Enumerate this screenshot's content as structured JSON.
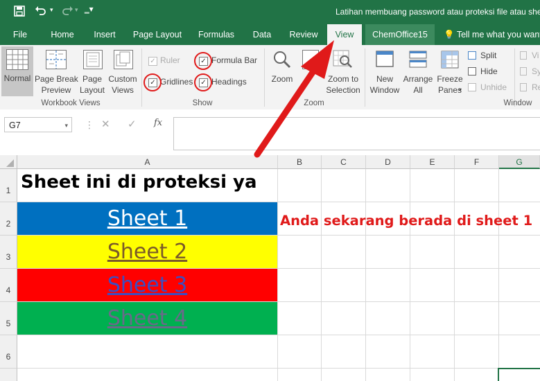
{
  "window": {
    "title": "Latihan membuang password atau proteksi file atau she"
  },
  "quick_access": {
    "save_icon": "save-icon",
    "undo_icon": "undo-icon",
    "redo_icon": "redo-icon",
    "customize_icon": "chevron-down-icon"
  },
  "tabs": [
    "File",
    "Home",
    "Insert",
    "Page Layout",
    "Formulas",
    "Data",
    "Review",
    "View",
    "ChemOffice15"
  ],
  "tell_me": "Tell me what you want",
  "ribbon": {
    "workbook_views": {
      "group_label": "Workbook Views",
      "normal": "Normal",
      "page_break_1": "Page Break",
      "page_break_2": "Preview",
      "page_layout_1": "Page",
      "page_layout_2": "Layout",
      "custom_views_1": "Custom",
      "custom_views_2": "Views"
    },
    "show": {
      "group_label": "Show",
      "ruler": "Ruler",
      "formula_bar": "Formula Bar",
      "gridlines": "Gridlines",
      "headings": "Headings"
    },
    "zoom": {
      "group_label": "Zoom",
      "zoom": "Zoom",
      "zoom_selection_1": "Zoom to",
      "zoom_selection_2": "Selection"
    },
    "window": {
      "group_label": "Window",
      "new_window_1": "New",
      "new_window_2": "Window",
      "arrange_all_1": "Arrange",
      "arrange_all_2": "All",
      "freeze_panes_1": "Freeze",
      "freeze_panes_2": "Panes",
      "split": "Split",
      "hide": "Hide",
      "unhide": "Unhide",
      "view_side": "Vi",
      "sync": "Sy",
      "reset": "Re"
    }
  },
  "formula_bar": {
    "name_box": "G7",
    "cancel_icon": "close-icon",
    "enter_icon": "check-icon",
    "function_label": "fx",
    "value": ""
  },
  "columns": [
    "A",
    "B",
    "C",
    "D",
    "E",
    "F",
    "G"
  ],
  "rows": [
    "1",
    "2",
    "3",
    "4",
    "5",
    "6"
  ],
  "cells": {
    "A1": "Sheet ini di proteksi ya",
    "A2": "Sheet 1",
    "A3": "Sheet 2",
    "A4": "Sheet 3",
    "A5": "Sheet 4",
    "B2": "Anda sekarang berada di sheet 1"
  },
  "colors": {
    "excel_green": "#217346",
    "sheet1_fill": "#0070c0",
    "sheet2_fill": "#ffff00",
    "sheet3_fill": "#ff0000",
    "sheet4_fill": "#00b050",
    "annotation_red": "#e01a1a"
  }
}
